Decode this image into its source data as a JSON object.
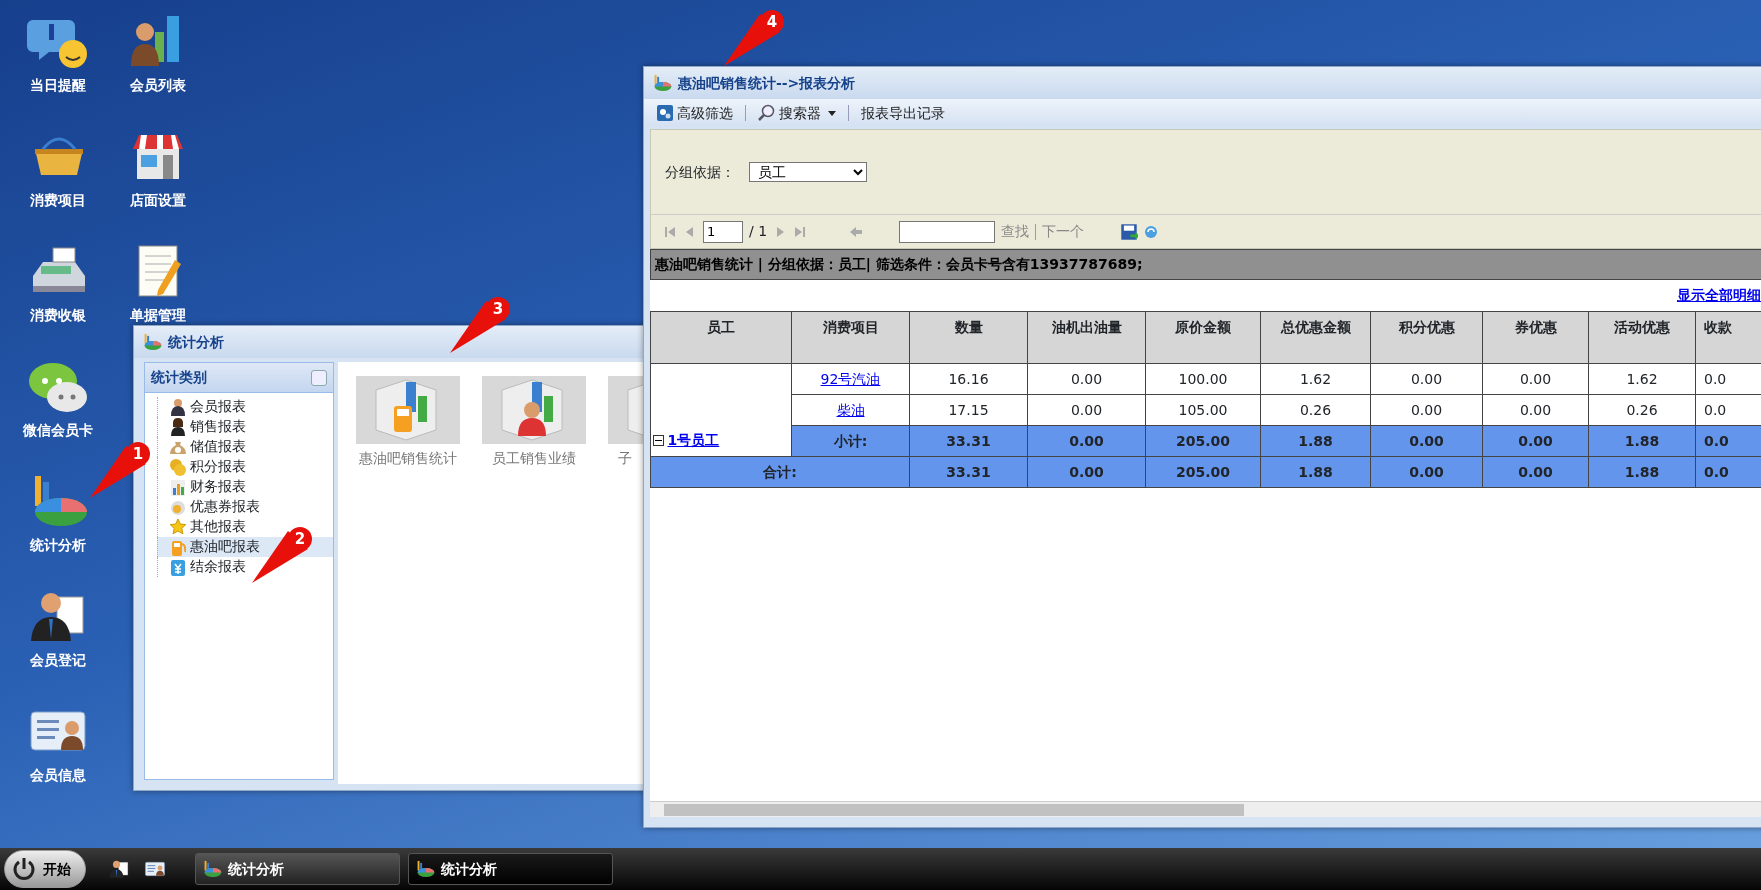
{
  "desktop_icons": [
    [
      {
        "label": "当日提醒",
        "kind": "bubble"
      },
      {
        "label": "消费项目",
        "kind": "basket"
      },
      {
        "label": "消费收银",
        "kind": "register"
      },
      {
        "label": "微信会员卡",
        "kind": "chat"
      },
      {
        "label": "统计分析",
        "kind": "pie"
      },
      {
        "label": "会员登记",
        "kind": "clipboard-person"
      },
      {
        "label": "会员信息",
        "kind": "card"
      }
    ],
    [
      {
        "label": "会员列表",
        "kind": "chart-person"
      },
      {
        "label": "店面设置",
        "kind": "shop"
      },
      {
        "label": "单据管理",
        "kind": "notepad"
      }
    ]
  ],
  "stats_window": {
    "title": "统计分析",
    "category_panel": {
      "title": "统计类别",
      "items": [
        {
          "label": "会员报表",
          "kind": "person",
          "selected": false
        },
        {
          "label": "销售报表",
          "kind": "woman",
          "selected": false
        },
        {
          "label": "储值报表",
          "kind": "moneybag",
          "selected": false
        },
        {
          "label": "积分报表",
          "kind": "coins",
          "selected": false
        },
        {
          "label": "财务报表",
          "kind": "bars",
          "selected": false
        },
        {
          "label": "优惠券报表",
          "kind": "coupon",
          "selected": false
        },
        {
          "label": "其他报表",
          "kind": "star",
          "selected": false
        },
        {
          "label": "惠油吧报表",
          "kind": "fuel",
          "selected": true
        },
        {
          "label": "结余报表",
          "kind": "yen",
          "selected": false
        }
      ]
    },
    "reports": [
      {
        "label": "惠油吧销售统计",
        "kind": "fuel"
      },
      {
        "label": "员工销售业绩",
        "kind": "worker"
      },
      {
        "label": "子",
        "kind": "other"
      }
    ]
  },
  "report_window": {
    "title": "惠油吧销售统计-->报表分析",
    "toolbar": [
      {
        "label": "高级筛选",
        "kind": "filter"
      },
      {
        "label": "搜索器",
        "kind": "search"
      },
      {
        "label": "报表导出记录",
        "kind": "text"
      }
    ],
    "group_by": {
      "label": "分组依据：",
      "value": "员工"
    },
    "pager": {
      "page": "1",
      "total": "/ 1",
      "find": "查找",
      "next": "下一个"
    },
    "report_header": "惠油吧销售统计 | 分组依据：员工| 筛选条件：会员卡号含有13937787689;",
    "show_all_link": "显示全部明细",
    "table": {
      "columns": [
        "员工",
        "消费项目",
        "数量",
        "油机出油量",
        "原价金额",
        "总优惠金额",
        "积分优惠",
        "券优惠",
        "活动优惠",
        "收款"
      ],
      "groups": [
        {
          "name": "1号员工",
          "expanded": true,
          "rows": [
            {
              "item": "92号汽油",
              "cells": [
                "16.16",
                "0.00",
                "100.00",
                "1.62",
                "0.00",
                "0.00",
                "1.62",
                "0.0"
              ]
            },
            {
              "item": "柴油",
              "cells": [
                "17.15",
                "0.00",
                "105.00",
                "0.26",
                "0.00",
                "0.00",
                "0.26",
                "0.0"
              ]
            }
          ],
          "subtotal_label": "小计:",
          "subtotal": [
            "33.31",
            "0.00",
            "205.00",
            "1.88",
            "0.00",
            "0.00",
            "1.88",
            "0.0"
          ]
        }
      ],
      "total_label": "合计:",
      "total": [
        "33.31",
        "0.00",
        "205.00",
        "1.88",
        "0.00",
        "0.00",
        "1.88",
        "0.0"
      ]
    }
  },
  "annotations": [
    {
      "label": "1"
    },
    {
      "label": "2"
    },
    {
      "label": "3"
    },
    {
      "label": "4"
    }
  ],
  "taskbar": {
    "start": "开始",
    "quick_launch": [
      {
        "kind": "person"
      },
      {
        "kind": "card"
      }
    ],
    "tasks": [
      {
        "label": "统计分析",
        "selected": false
      },
      {
        "label": "统计分析",
        "selected": true
      }
    ]
  }
}
